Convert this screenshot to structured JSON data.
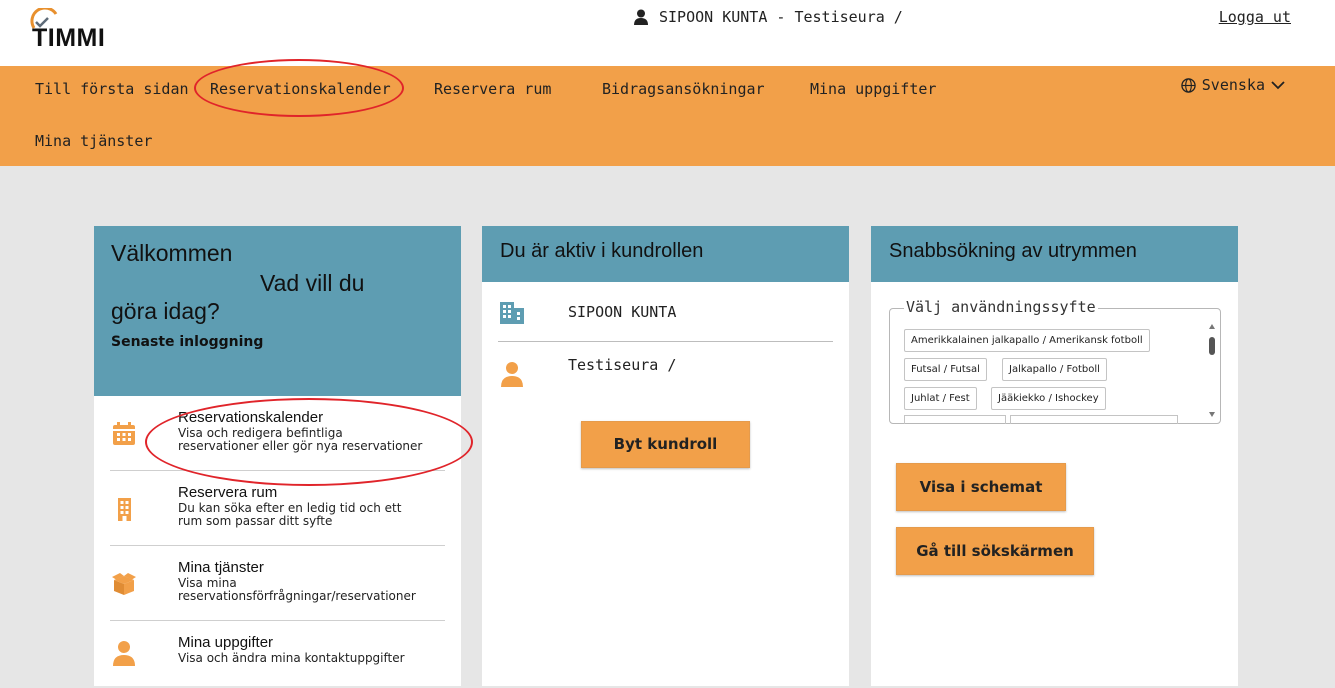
{
  "header": {
    "logo_text": "TIMMI",
    "user_label": "SIPOON KUNTA - Testiseura /",
    "logout_label": "Logga ut"
  },
  "nav": {
    "items": [
      "Till första sidan",
      "Reservationskalender",
      "Reservera rum",
      "Bidragsansökningar",
      "Mina uppgifter",
      "Mina tjänster"
    ],
    "language": "Svenska"
  },
  "welcome": {
    "title": "Välkommen",
    "subtitle_part1": "Vad vill du",
    "subtitle_part2": "göra idag?",
    "last_login": "Senaste inloggning",
    "items": [
      {
        "title": "Reservationskalender",
        "desc_line1": "Visa och redigera befintliga",
        "desc_line2": "reservationer eller gör nya reservationer",
        "icon": "calendar-icon"
      },
      {
        "title": "Reservera rum",
        "desc_line1": "Du kan söka efter en ledig tid och ett",
        "desc_line2": "rum som passar ditt syfte",
        "icon": "building-icon"
      },
      {
        "title": "Mina tjänster",
        "desc_line1": "Visa mina",
        "desc_line2": "reservationsförfrågningar/reservationer",
        "icon": "box-icon"
      },
      {
        "title": "Mina uppgifter",
        "desc_line1": "Visa och ändra mina kontaktuppgifter",
        "desc_line2": "",
        "icon": "person-icon"
      }
    ]
  },
  "role": {
    "title": "Du är aktiv i kundrollen",
    "organization": "SIPOON KUNTA",
    "user": "Testiseura /",
    "switch_button": "Byt kundroll"
  },
  "quick_search": {
    "title": "Snabbsökning av utrymmen",
    "purpose_label": "Välj användningssyfte",
    "chips": [
      "Amerikkalainen jalkapallo / Amerikansk fotboll",
      "Futsal / Futsal",
      "Jalkapallo / Fotboll",
      "Juhlat / Fest",
      "Jääkiekko / Ishockey"
    ],
    "show_schedule_button": "Visa i schemat",
    "go_search_button": "Gå till sökskärmen"
  },
  "colors": {
    "accent": "#f2a049",
    "card_header": "#5e9db2",
    "background": "#e6e6e6",
    "annotation": "#e0242a"
  }
}
